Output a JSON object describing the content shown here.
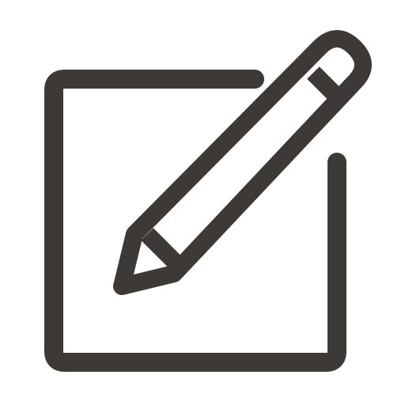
{
  "icon": {
    "name": "edit-icon",
    "parts": [
      "document-frame",
      "pencil"
    ],
    "stroke_color": "#3d3937",
    "background_color": "#ffffff"
  }
}
